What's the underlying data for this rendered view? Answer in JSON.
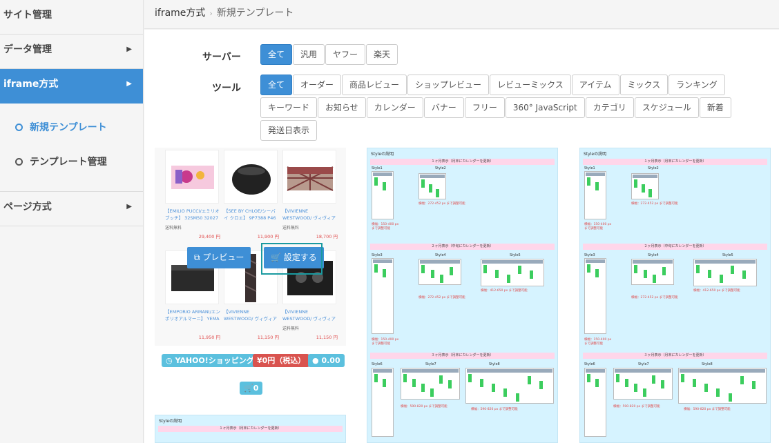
{
  "sidebar": {
    "items": [
      {
        "label": "サイト管理"
      },
      {
        "label": "データ管理",
        "chevron": "›"
      },
      {
        "label": "iframe方式",
        "chevron": "›"
      },
      {
        "label": "ページ方式",
        "chevron": "›"
      }
    ],
    "subitems": [
      {
        "label": "新規テンプレート"
      },
      {
        "label": "テンプレート管理"
      }
    ]
  },
  "breadcrumb": {
    "parent": "iframe方式",
    "separator": "›",
    "current": "新規テンプレート"
  },
  "filters": {
    "server": {
      "label": "サーバー",
      "options": [
        "全て",
        "汎用",
        "ヤフー",
        "楽天"
      ],
      "selected": "全て"
    },
    "tool": {
      "label": "ツール",
      "options": [
        "全て",
        "オーダー",
        "商品レビュー",
        "ショップレビュー",
        "レビューミックス",
        "アイテム",
        "ミックス",
        "ランキング",
        "キーワード",
        "お知らせ",
        "カレンダー",
        "バナー",
        "フリー",
        "360° JavaScript",
        "カテゴリ",
        "スケジュール",
        "新着",
        "発送日表示"
      ],
      "selected": "全て"
    }
  },
  "template_card": {
    "products": [
      {
        "name": "【EMILIO PUCCI/エミリオ ブッチ】 32SM50 32027",
        "shipping": "送料無料",
        "price": "29,400 円"
      },
      {
        "name": "【SEE BY CHLOE/シーバイ クロエ】 9P7388 P46 Pd",
        "shipping": "",
        "price": "11,900 円"
      },
      {
        "name": "【VIVIENNE WESTWOOD/ ヴィヴィアンウエストウッ",
        "shipping": "送料無料",
        "price": "18,700 円"
      },
      {
        "name": "【EMPORIO ARMANI/エン ポリオアルマーニ】 YEMA",
        "shipping": "",
        "price": "11,950 円"
      },
      {
        "name": "【VIVIENNE WESTWOOD/ ヴィヴィアンウエストウッ",
        "shipping": "",
        "price": "11,150 円"
      },
      {
        "name": "【VIVIENNE WESTWOOD/ ヴィヴィアンウエストウッ",
        "shipping": "送料無料",
        "price": "11,150 円"
      }
    ],
    "preview_button": "プレビュー",
    "set_button": "設定する",
    "shop_badge": "YAHOO!ショッピング",
    "price_badge": "¥0円（税込）",
    "comment_badge": "0.00",
    "cart_badge": "0",
    "colors": {
      "shop": "#5bc0de",
      "price": "#d9534f",
      "comment": "#5bc0de",
      "cart": "#5bc0de",
      "highlight": "#1a9aa0"
    }
  },
  "calendar_preview": {
    "heading": "Styleの説明",
    "band1": "１ヶ月表示（月末にカレンダーを更新）",
    "band2": "２ヶ月表示（中旬にカレンダーを更新）",
    "band3": "３ヶ月表示（月末にカレンダーを更新）",
    "style1": "Style1",
    "style2": "Style2",
    "style3": "Style3",
    "style4": "Style4",
    "style5": "Style5",
    "style6": "Style6",
    "style7": "Style7",
    "style8": "Style8",
    "note1": "横幅：150-400 px まで調整可能",
    "note2": "横幅：272-452 px まで調整可能",
    "note3": "横幅：412-650 px まで調整可能",
    "note4": "横幅：590-820 px まで調整可能"
  },
  "colors": {
    "accent": "#3e8fd6",
    "sidebar_bg": "#f5f5f5",
    "preview_bg": "#d6f3ff",
    "preview_band": "#ffd6ea",
    "calendar_green": "#3ccd5e"
  }
}
